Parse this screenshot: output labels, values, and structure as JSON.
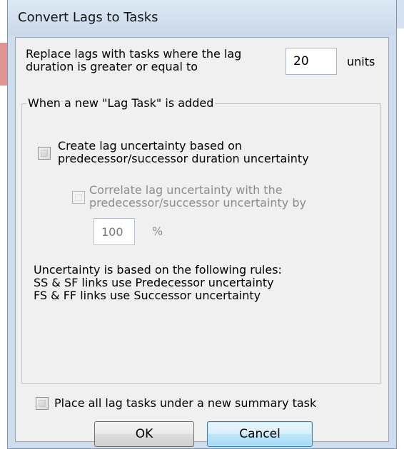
{
  "window": {
    "title": "Convert Lags to Tasks"
  },
  "threshold": {
    "label_line1": "Replace lags with tasks where the lag",
    "label_line2": "duration is greater or equal to",
    "value": "20",
    "units": "units"
  },
  "lag_task_group": {
    "legend": "When a new \"Lag Task\" is added",
    "create_uncertainty": {
      "checked": false,
      "label_line1": "Create lag uncertainty based on",
      "label_line2": "predecessor/successor duration uncertainty"
    },
    "correlate": {
      "checked": false,
      "enabled": false,
      "label_line1": "Correlate lag uncertainty with the",
      "label_line2": "predecessor/successor uncertainty by",
      "value": "100",
      "unit": "%"
    },
    "rules": {
      "line1": "Uncertainty is based on the following rules:",
      "line2": "SS & SF links use Predecessor uncertainty",
      "line3": "FS & FF links use Successor uncertainty"
    }
  },
  "summary_task": {
    "checked": false,
    "label": "Place all lag tasks under a new summary task"
  },
  "buttons": {
    "ok": "OK",
    "cancel": "Cancel"
  }
}
